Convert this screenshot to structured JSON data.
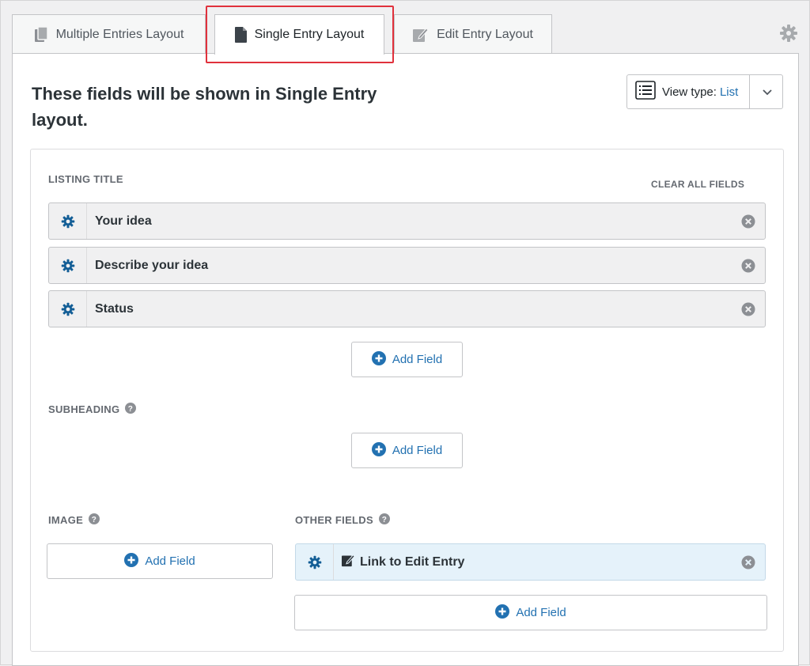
{
  "tabs": [
    {
      "label": "Multiple Entries Layout",
      "icon": "copy-pages-icon"
    },
    {
      "label": "Single Entry Layout",
      "icon": "document-icon",
      "active": true
    },
    {
      "label": "Edit Entry Layout",
      "icon": "edit-icon"
    }
  ],
  "header": {
    "title": "These fields will be shown in Single Entry layout.",
    "view_type_label": "View type:",
    "view_type_value": "List"
  },
  "listing_title": {
    "label": "LISTING TITLE",
    "clear_all": "CLEAR ALL FIELDS",
    "fields": [
      "Your idea",
      "Describe your idea",
      "Status"
    ],
    "add_label": "Add Field"
  },
  "subheading": {
    "label": "SUBHEADING",
    "add_label": "Add Field"
  },
  "image": {
    "label": "IMAGE",
    "add_label": "Add Field"
  },
  "other_fields": {
    "label": "OTHER FIELDS",
    "fields": [
      "Link to Edit Entry"
    ],
    "add_label": "Add Field"
  },
  "colors": {
    "accent": "#2271b1",
    "gear_blue": "#135e96",
    "highlight": "#e0313c",
    "field_blue_bg": "#e5f2fa"
  }
}
